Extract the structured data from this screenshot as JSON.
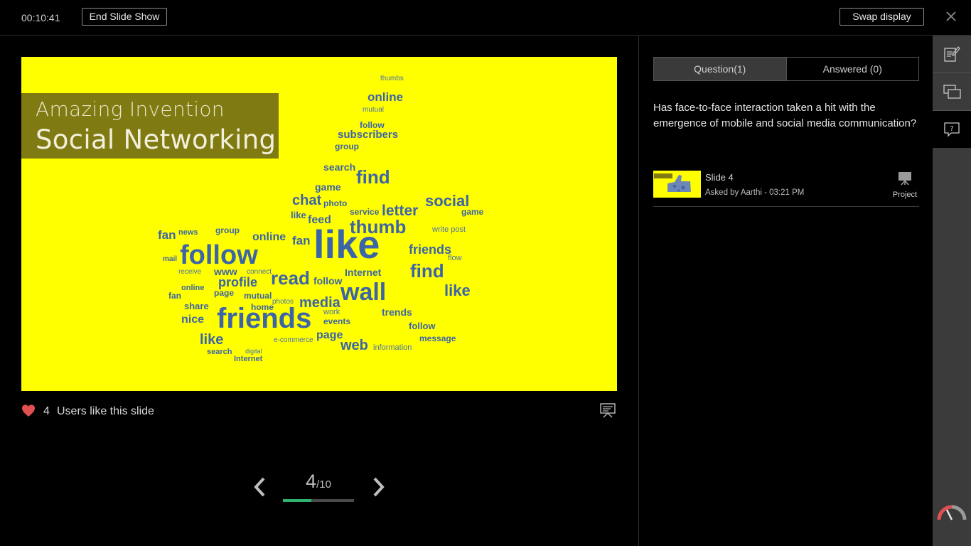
{
  "topbar": {
    "timer": "00:10:41",
    "end_slideshow_label": "End Slide Show",
    "swap_display_label": "Swap display"
  },
  "slide": {
    "title_line1": "Amazing Invention",
    "title_line2": "Social Networking",
    "background_color": "#ffff00",
    "words": {
      "big_like": "like",
      "big_follow": "follow",
      "big_friends": "friends",
      "big_wall": "wall",
      "big_thumb": "thumb",
      "find1": "find",
      "social": "social",
      "letter": "letter",
      "chat": "chat",
      "read": "read",
      "media": "media",
      "web": "web",
      "profile": "profile",
      "online": "online",
      "subscribers": "subscribers",
      "search": "search",
      "game": "game",
      "feed": "feed",
      "fan": "fan",
      "nice": "nice",
      "share": "share",
      "like2": "like",
      "like3": "like",
      "find2": "find",
      "www": "www",
      "trends": "trends",
      "page": "page",
      "service": "service",
      "internet": "Internet",
      "follow2": "follow",
      "friends2": "friends",
      "photo": "photo",
      "group": "group",
      "news": "news",
      "mutual": "mutual",
      "events": "events",
      "message": "message",
      "information": "information",
      "home": "home",
      "photos": "photos",
      "receive": "receive",
      "connect": "connect",
      "mail": "mail",
      "thumbs": "thumbs",
      "add": "add",
      "work": "work",
      "write_post": "write post",
      "ecommerce": "e-commerce",
      "digital": "digital",
      "flow": "flow"
    }
  },
  "likes": {
    "count": "4",
    "text": "Users like this slide"
  },
  "pager": {
    "current": "4",
    "total": "/10",
    "progress_fraction": 0.4,
    "progress_color": "#2fb26b"
  },
  "qa": {
    "tab_questions": "Question(1)",
    "tab_answered": "Answered (0)",
    "question_text": "Has face-to-face interaction taken a hit with the emergence of mobile and social media communication?",
    "item": {
      "slide": "Slide 4",
      "asked_by": "Asked by Aarthi - 03:21 PM",
      "project_label": "Project"
    }
  },
  "icons": {
    "close": "close-icon",
    "heart": "heart-icon",
    "present": "presentation-board-icon",
    "prev": "chevron-left-icon",
    "next": "chevron-right-icon",
    "project": "projector-screen-icon",
    "notes": "notes-edit-icon",
    "slides": "slides-overlap-icon",
    "question": "question-bubble-icon",
    "gauge": "gauge-icon"
  },
  "colors": {
    "heart": "#e05050",
    "wordcloud": "#3c64a8",
    "title_box": "#807a12"
  }
}
